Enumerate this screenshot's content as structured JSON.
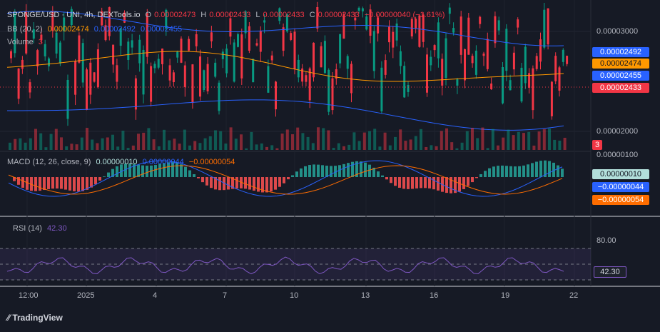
{
  "header": {
    "symbol": "SPONGE/USD · UNI, 4h, DEXTools.io",
    "o_label": "O",
    "o_value": "0.00002473",
    "h_label": "H",
    "h_value": "0.00002433",
    "l_label": "L",
    "l_value": "0.00002433",
    "c_label": "C",
    "c_value": "0.00002433",
    "change": "−0.00000040 (−1.61%)",
    "bb_label": "BB (20, 2)",
    "bb_basis": "0.00002474",
    "bb_upper": "0.00002492",
    "bb_lower": "0.00002455",
    "vol_label": "Volume",
    "vol_value": "3"
  },
  "price_axis": {
    "ticks": [
      "0.00003000",
      "0.00002000"
    ],
    "badges": [
      {
        "text": "0.00002492",
        "color": "#2962ff"
      },
      {
        "text": "0.00002474",
        "color": "#ff9800"
      },
      {
        "text": "0.00002455",
        "color": "#2962ff"
      },
      {
        "text": "0.00002433",
        "color": "#f23645"
      }
    ],
    "volume_badge": "3"
  },
  "macd": {
    "label": "MACD (12, 26, close, 9)",
    "v1": "0.00000010",
    "v2": "0.00000044",
    "v3": "−0.00000054",
    "axis_top": "0.00000100",
    "badges": [
      {
        "text": "0.00000010",
        "color": "#b2dfdb",
        "fg": "#131722"
      },
      {
        "text": "−0.00000044",
        "color": "#2962ff",
        "fg": "#ffffff"
      },
      {
        "text": "−0.00000054",
        "color": "#ff6d00",
        "fg": "#ffffff"
      }
    ]
  },
  "rsi": {
    "label": "RSI (14)",
    "value": "42.30",
    "level": 42.3,
    "axis_tick": "80.00",
    "badge": "42.30"
  },
  "x_axis": [
    "12:00",
    "2025",
    "4",
    "7",
    "10",
    "13",
    "16",
    "19",
    "22"
  ],
  "brand": "TradingView",
  "colors": {
    "bg": "#161a25",
    "up": "#089981",
    "down": "#f23645",
    "bb_mid": "#ff9800",
    "bb_band": "#2962ff",
    "rsi": "#7e57c2"
  }
}
